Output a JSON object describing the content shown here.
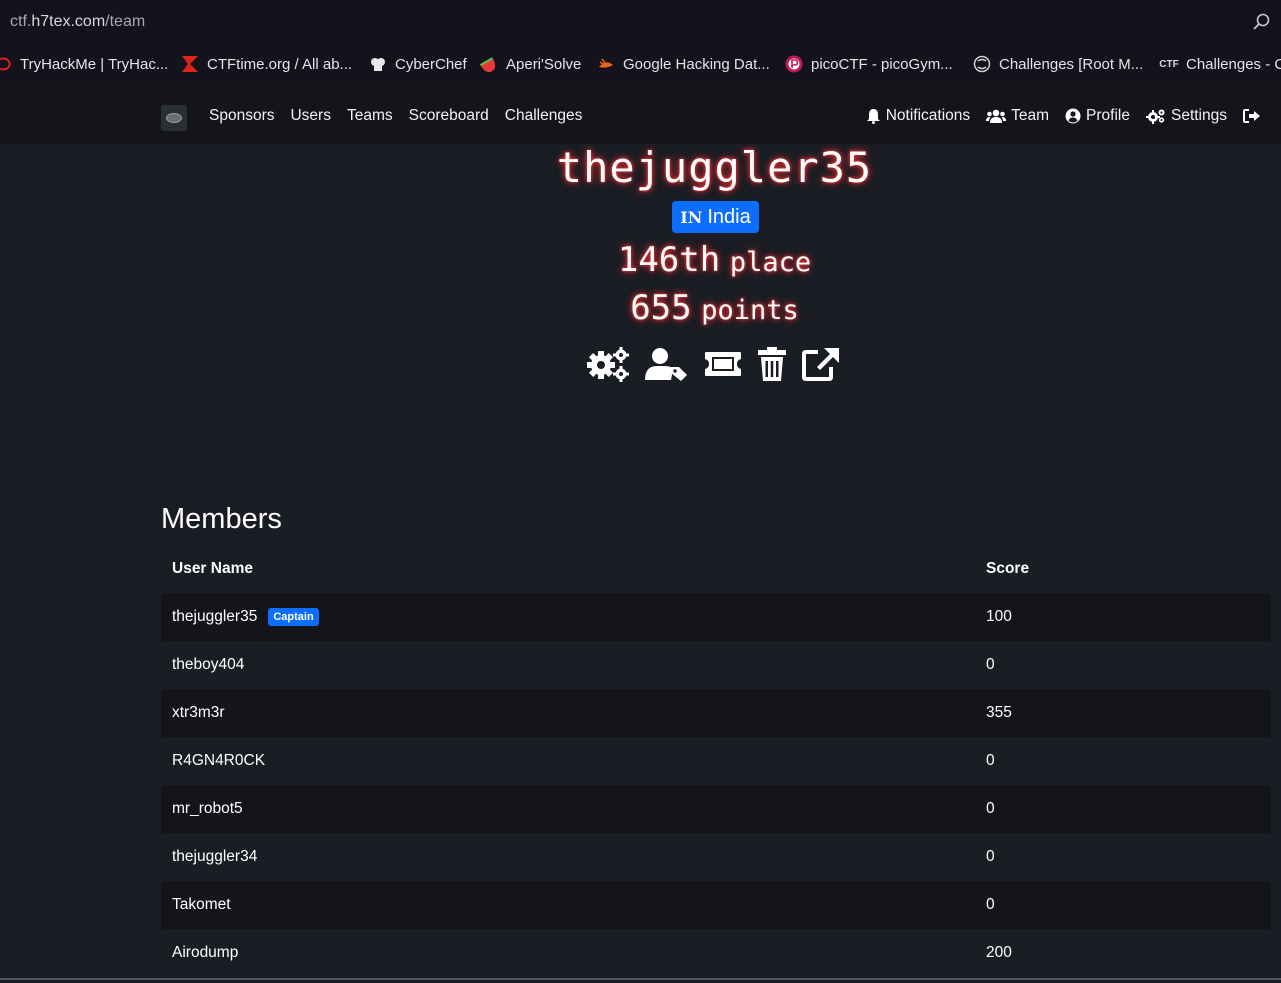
{
  "browser": {
    "url_prefix": "ctf.",
    "url_host": "h7tex.com",
    "url_path": "/team",
    "bookmarks": [
      {
        "label": "TryHackMe | TryHac...",
        "icon": "tryhackme-icon"
      },
      {
        "label": "CTFtime.org / All ab...",
        "icon": "ctftime-icon"
      },
      {
        "label": "CyberChef",
        "icon": "cyberchef-icon"
      },
      {
        "label": "Aperi'Solve",
        "icon": "aperisolve-icon"
      },
      {
        "label": "Google Hacking Dat...",
        "icon": "exploitdb-icon"
      },
      {
        "label": "picoCTF - picoGym...",
        "icon": "picoctf-icon"
      },
      {
        "label": "Challenges [Root M...",
        "icon": "rootme-icon"
      },
      {
        "label": "Challenges - C",
        "icon": "ctf-icon",
        "icon_text": "CTF"
      }
    ]
  },
  "nav": {
    "links": [
      "Sponsors",
      "Users",
      "Teams",
      "Scoreboard",
      "Challenges"
    ],
    "notifications": "Notifications",
    "team": "Team",
    "profile": "Profile",
    "settings": "Settings"
  },
  "team": {
    "name": "thejuggler35",
    "country_code": "IN",
    "country": "India",
    "place_number": "146th",
    "place_label": "place",
    "points_number": "655",
    "points_label": "points"
  },
  "members": {
    "title": "Members",
    "columns": [
      "User Name",
      "Score"
    ],
    "captain_label": "Captain",
    "rows": [
      {
        "name": "thejuggler35",
        "score": "100"
      },
      {
        "name": "theboy404",
        "score": "0"
      },
      {
        "name": "xtr3m3r",
        "score": "355"
      },
      {
        "name": "R4GN4R0CK",
        "score": "0"
      },
      {
        "name": "mr_robot5",
        "score": "0"
      },
      {
        "name": "thejuggler34",
        "score": "0"
      },
      {
        "name": "Takomet",
        "score": "0"
      },
      {
        "name": "Airodump",
        "score": "200"
      }
    ]
  },
  "colors": {
    "accent": "#0d6efd",
    "glow": "#ff2a2a",
    "background": "#1a1d24"
  }
}
